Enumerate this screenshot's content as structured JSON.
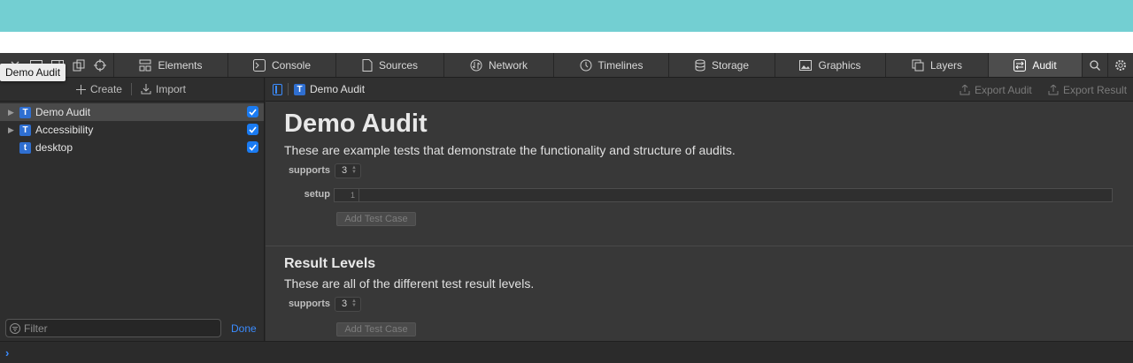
{
  "tooltip": "Demo Audit",
  "tabs": [
    {
      "label": "Elements"
    },
    {
      "label": "Console"
    },
    {
      "label": "Sources"
    },
    {
      "label": "Network"
    },
    {
      "label": "Timelines"
    },
    {
      "label": "Storage"
    },
    {
      "label": "Graphics"
    },
    {
      "label": "Layers"
    },
    {
      "label": "Audit",
      "active": true
    }
  ],
  "sidebar": {
    "create_label": "Create",
    "import_label": "Import",
    "items": [
      {
        "label": "Demo Audit",
        "icon": "T",
        "checked": true,
        "selected": true,
        "expandable": true
      },
      {
        "label": "Accessibility",
        "icon": "T",
        "checked": true,
        "expandable": true
      },
      {
        "label": "desktop",
        "icon": "t",
        "checked": true,
        "expandable": false
      }
    ],
    "filter_placeholder": "Filter",
    "done_label": "Done"
  },
  "main": {
    "breadcrumb": "Demo Audit",
    "export_audit": "Export Audit",
    "export_result": "Export Result",
    "audit": {
      "title": "Demo Audit",
      "description": "These are example tests that demonstrate the functionality and structure of audits.",
      "supports_label": "supports",
      "supports_value": "3",
      "setup_label": "setup",
      "setup_line": "1",
      "add_test_case": "Add Test Case"
    },
    "result_levels": {
      "title": "Result Levels",
      "description": "These are all of the different test result levels.",
      "supports_label": "supports",
      "supports_value": "3",
      "add_test_case": "Add Test Case"
    }
  },
  "colors": {
    "accent": "#3b8cff",
    "top_banner": "#73cfd2",
    "checkbox": "#1a7bf2"
  }
}
